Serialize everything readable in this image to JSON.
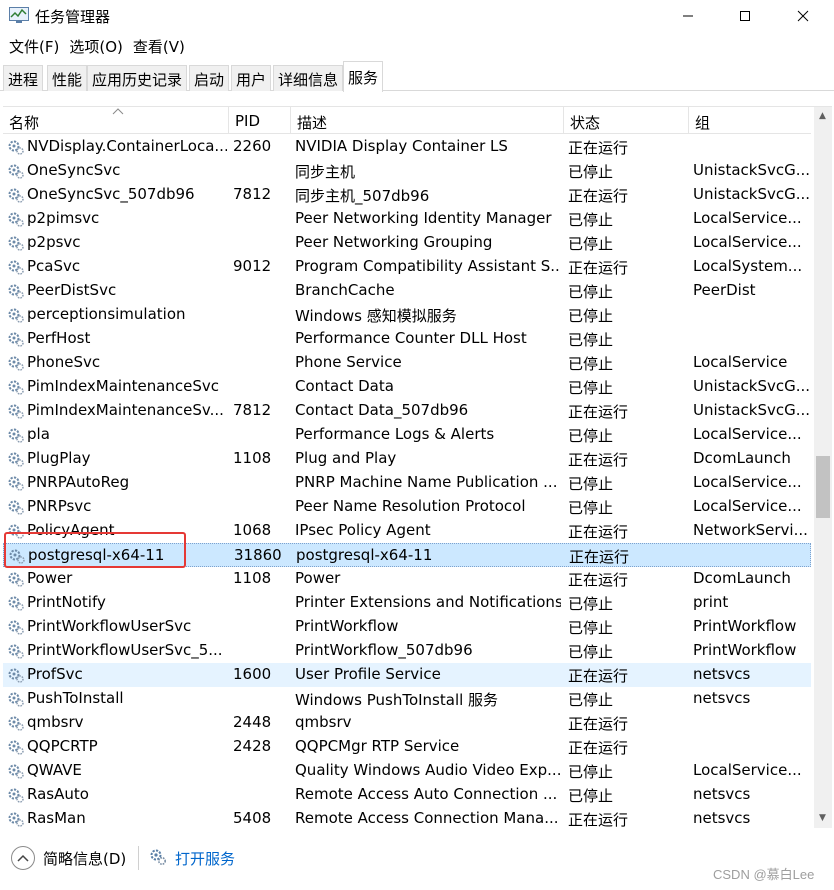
{
  "window": {
    "title": "任务管理器",
    "controls": {
      "minimize": "–",
      "maximize": "☐",
      "close": "✕"
    }
  },
  "menu": [
    "文件(F)",
    "选项(O)",
    "查看(V)"
  ],
  "tabs": [
    "进程",
    "性能",
    "应用历史记录",
    "启动",
    "用户",
    "详细信息",
    "服务"
  ],
  "active_tab": "服务",
  "table": {
    "columns": [
      "名称",
      "PID",
      "描述",
      "状态",
      "组"
    ],
    "rows": [
      {
        "name": "NVDisplay.ContainerLoca...",
        "pid": "2260",
        "desc": "NVIDIA Display Container LS",
        "status": "正在运行",
        "group": ""
      },
      {
        "name": "OneSyncSvc",
        "pid": "",
        "desc": "同步主机",
        "status": "已停止",
        "group": "UnistackSvcG..."
      },
      {
        "name": "OneSyncSvc_507db96",
        "pid": "7812",
        "desc": "同步主机_507db96",
        "status": "正在运行",
        "group": "UnistackSvcG..."
      },
      {
        "name": "p2pimsvc",
        "pid": "",
        "desc": "Peer Networking Identity Manager",
        "status": "已停止",
        "group": "LocalService..."
      },
      {
        "name": "p2psvc",
        "pid": "",
        "desc": "Peer Networking Grouping",
        "status": "已停止",
        "group": "LocalService..."
      },
      {
        "name": "PcaSvc",
        "pid": "9012",
        "desc": "Program Compatibility Assistant S...",
        "status": "正在运行",
        "group": "LocalSystem..."
      },
      {
        "name": "PeerDistSvc",
        "pid": "",
        "desc": "BranchCache",
        "status": "已停止",
        "group": "PeerDist"
      },
      {
        "name": "perceptionsimulation",
        "pid": "",
        "desc": "Windows 感知模拟服务",
        "status": "已停止",
        "group": ""
      },
      {
        "name": "PerfHost",
        "pid": "",
        "desc": "Performance Counter DLL Host",
        "status": "已停止",
        "group": ""
      },
      {
        "name": "PhoneSvc",
        "pid": "",
        "desc": "Phone Service",
        "status": "已停止",
        "group": "LocalService"
      },
      {
        "name": "PimIndexMaintenanceSvc",
        "pid": "",
        "desc": "Contact Data",
        "status": "已停止",
        "group": "UnistackSvcG..."
      },
      {
        "name": "PimIndexMaintenanceSv...",
        "pid": "7812",
        "desc": "Contact Data_507db96",
        "status": "正在运行",
        "group": "UnistackSvcG..."
      },
      {
        "name": "pla",
        "pid": "",
        "desc": "Performance Logs & Alerts",
        "status": "已停止",
        "group": "LocalService..."
      },
      {
        "name": "PlugPlay",
        "pid": "1108",
        "desc": "Plug and Play",
        "status": "正在运行",
        "group": "DcomLaunch"
      },
      {
        "name": "PNRPAutoReg",
        "pid": "",
        "desc": "PNRP Machine Name Publication ...",
        "status": "已停止",
        "group": "LocalService..."
      },
      {
        "name": "PNRPsvc",
        "pid": "",
        "desc": "Peer Name Resolution Protocol",
        "status": "已停止",
        "group": "LocalService..."
      },
      {
        "name": "PolicyAgent",
        "pid": "1068",
        "desc": "IPsec Policy Agent",
        "status": "正在运行",
        "group": "NetworkServi..."
      },
      {
        "name": "postgresql-x64-11",
        "pid": "31860",
        "desc": "postgresql-x64-11",
        "status": "正在运行",
        "group": ""
      },
      {
        "name": "Power",
        "pid": "1108",
        "desc": "Power",
        "status": "正在运行",
        "group": "DcomLaunch"
      },
      {
        "name": "PrintNotify",
        "pid": "",
        "desc": "Printer Extensions and Notifications",
        "status": "已停止",
        "group": "print"
      },
      {
        "name": "PrintWorkflowUserSvc",
        "pid": "",
        "desc": "PrintWorkflow",
        "status": "已停止",
        "group": "PrintWorkflow"
      },
      {
        "name": "PrintWorkflowUserSvc_5...",
        "pid": "",
        "desc": "PrintWorkflow_507db96",
        "status": "已停止",
        "group": "PrintWorkflow"
      },
      {
        "name": "ProfSvc",
        "pid": "1600",
        "desc": "User Profile Service",
        "status": "正在运行",
        "group": "netsvcs"
      },
      {
        "name": "PushToInstall",
        "pid": "",
        "desc": "Windows PushToInstall 服务",
        "status": "已停止",
        "group": "netsvcs"
      },
      {
        "name": "qmbsrv",
        "pid": "2448",
        "desc": "qmbsrv",
        "status": "正在运行",
        "group": ""
      },
      {
        "name": "QQPCRTP",
        "pid": "2428",
        "desc": "QQPCMgr RTP Service",
        "status": "正在运行",
        "group": ""
      },
      {
        "name": "QWAVE",
        "pid": "",
        "desc": "Quality Windows Audio Video Exp...",
        "status": "已停止",
        "group": "LocalService..."
      },
      {
        "name": "RasAuto",
        "pid": "",
        "desc": "Remote Access Auto Connection ...",
        "status": "已停止",
        "group": "netsvcs"
      },
      {
        "name": "RasMan",
        "pid": "5408",
        "desc": "Remote Access Connection Mana...",
        "status": "正在运行",
        "group": "netsvcs"
      }
    ],
    "selected_row": "postgresql-x64-11",
    "hover_row": "ProfSvc"
  },
  "footer": {
    "fewer_details": "简略信息(D)",
    "open_services": "打开服务"
  },
  "watermark": "CSDN @慕白Lee",
  "colors": {
    "selected_row": "#cce8ff",
    "hover_row": "#e5f3ff",
    "highlight_box": "#e53935",
    "link": "#0066cc"
  }
}
